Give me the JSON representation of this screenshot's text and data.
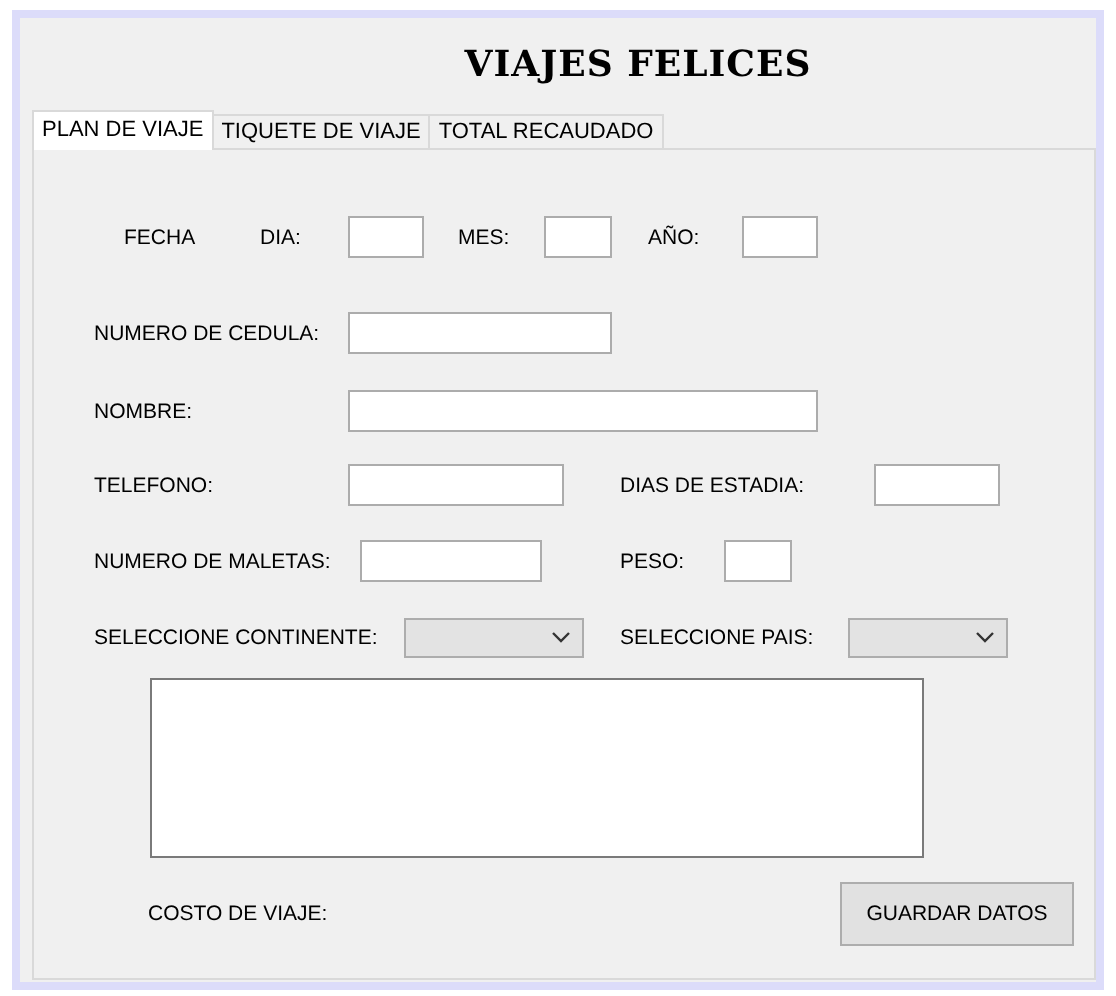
{
  "title": "VIAJES FELICES",
  "tabs": [
    {
      "label": "PLAN DE VIAJE",
      "selected": true
    },
    {
      "label": "TIQUETE DE VIAJE",
      "selected": false
    },
    {
      "label": "TOTAL RECAUDADO",
      "selected": false
    }
  ],
  "form_rows": [
    [
      {
        "kind": "caption",
        "label": "FECHA"
      },
      {
        "kind": "field",
        "label": "DIA:"
      },
      {
        "kind": "field",
        "label": "MES:"
      },
      {
        "kind": "field",
        "label": "AÑO:"
      }
    ],
    [
      {
        "kind": "field",
        "label": "NUMERO DE CEDULA:"
      }
    ],
    [
      {
        "kind": "field",
        "label": "NOMBRE:"
      }
    ],
    [
      {
        "kind": "field",
        "label": "TELEFONO:"
      },
      {
        "kind": "field",
        "label": "DIAS DE ESTADIA:"
      }
    ],
    [
      {
        "kind": "field",
        "label": "NUMERO DE MALETAS:"
      },
      {
        "kind": "field",
        "label": "PESO:"
      }
    ],
    [
      {
        "kind": "dropdown",
        "label": "SELECCIONE CONTINENTE:"
      },
      {
        "kind": "dropdown",
        "label": "SELECCIONE PAIS:"
      }
    ]
  ],
  "cost_label": "COSTO DE VIAJE:",
  "save_button": "GUARDAR DATOS"
}
